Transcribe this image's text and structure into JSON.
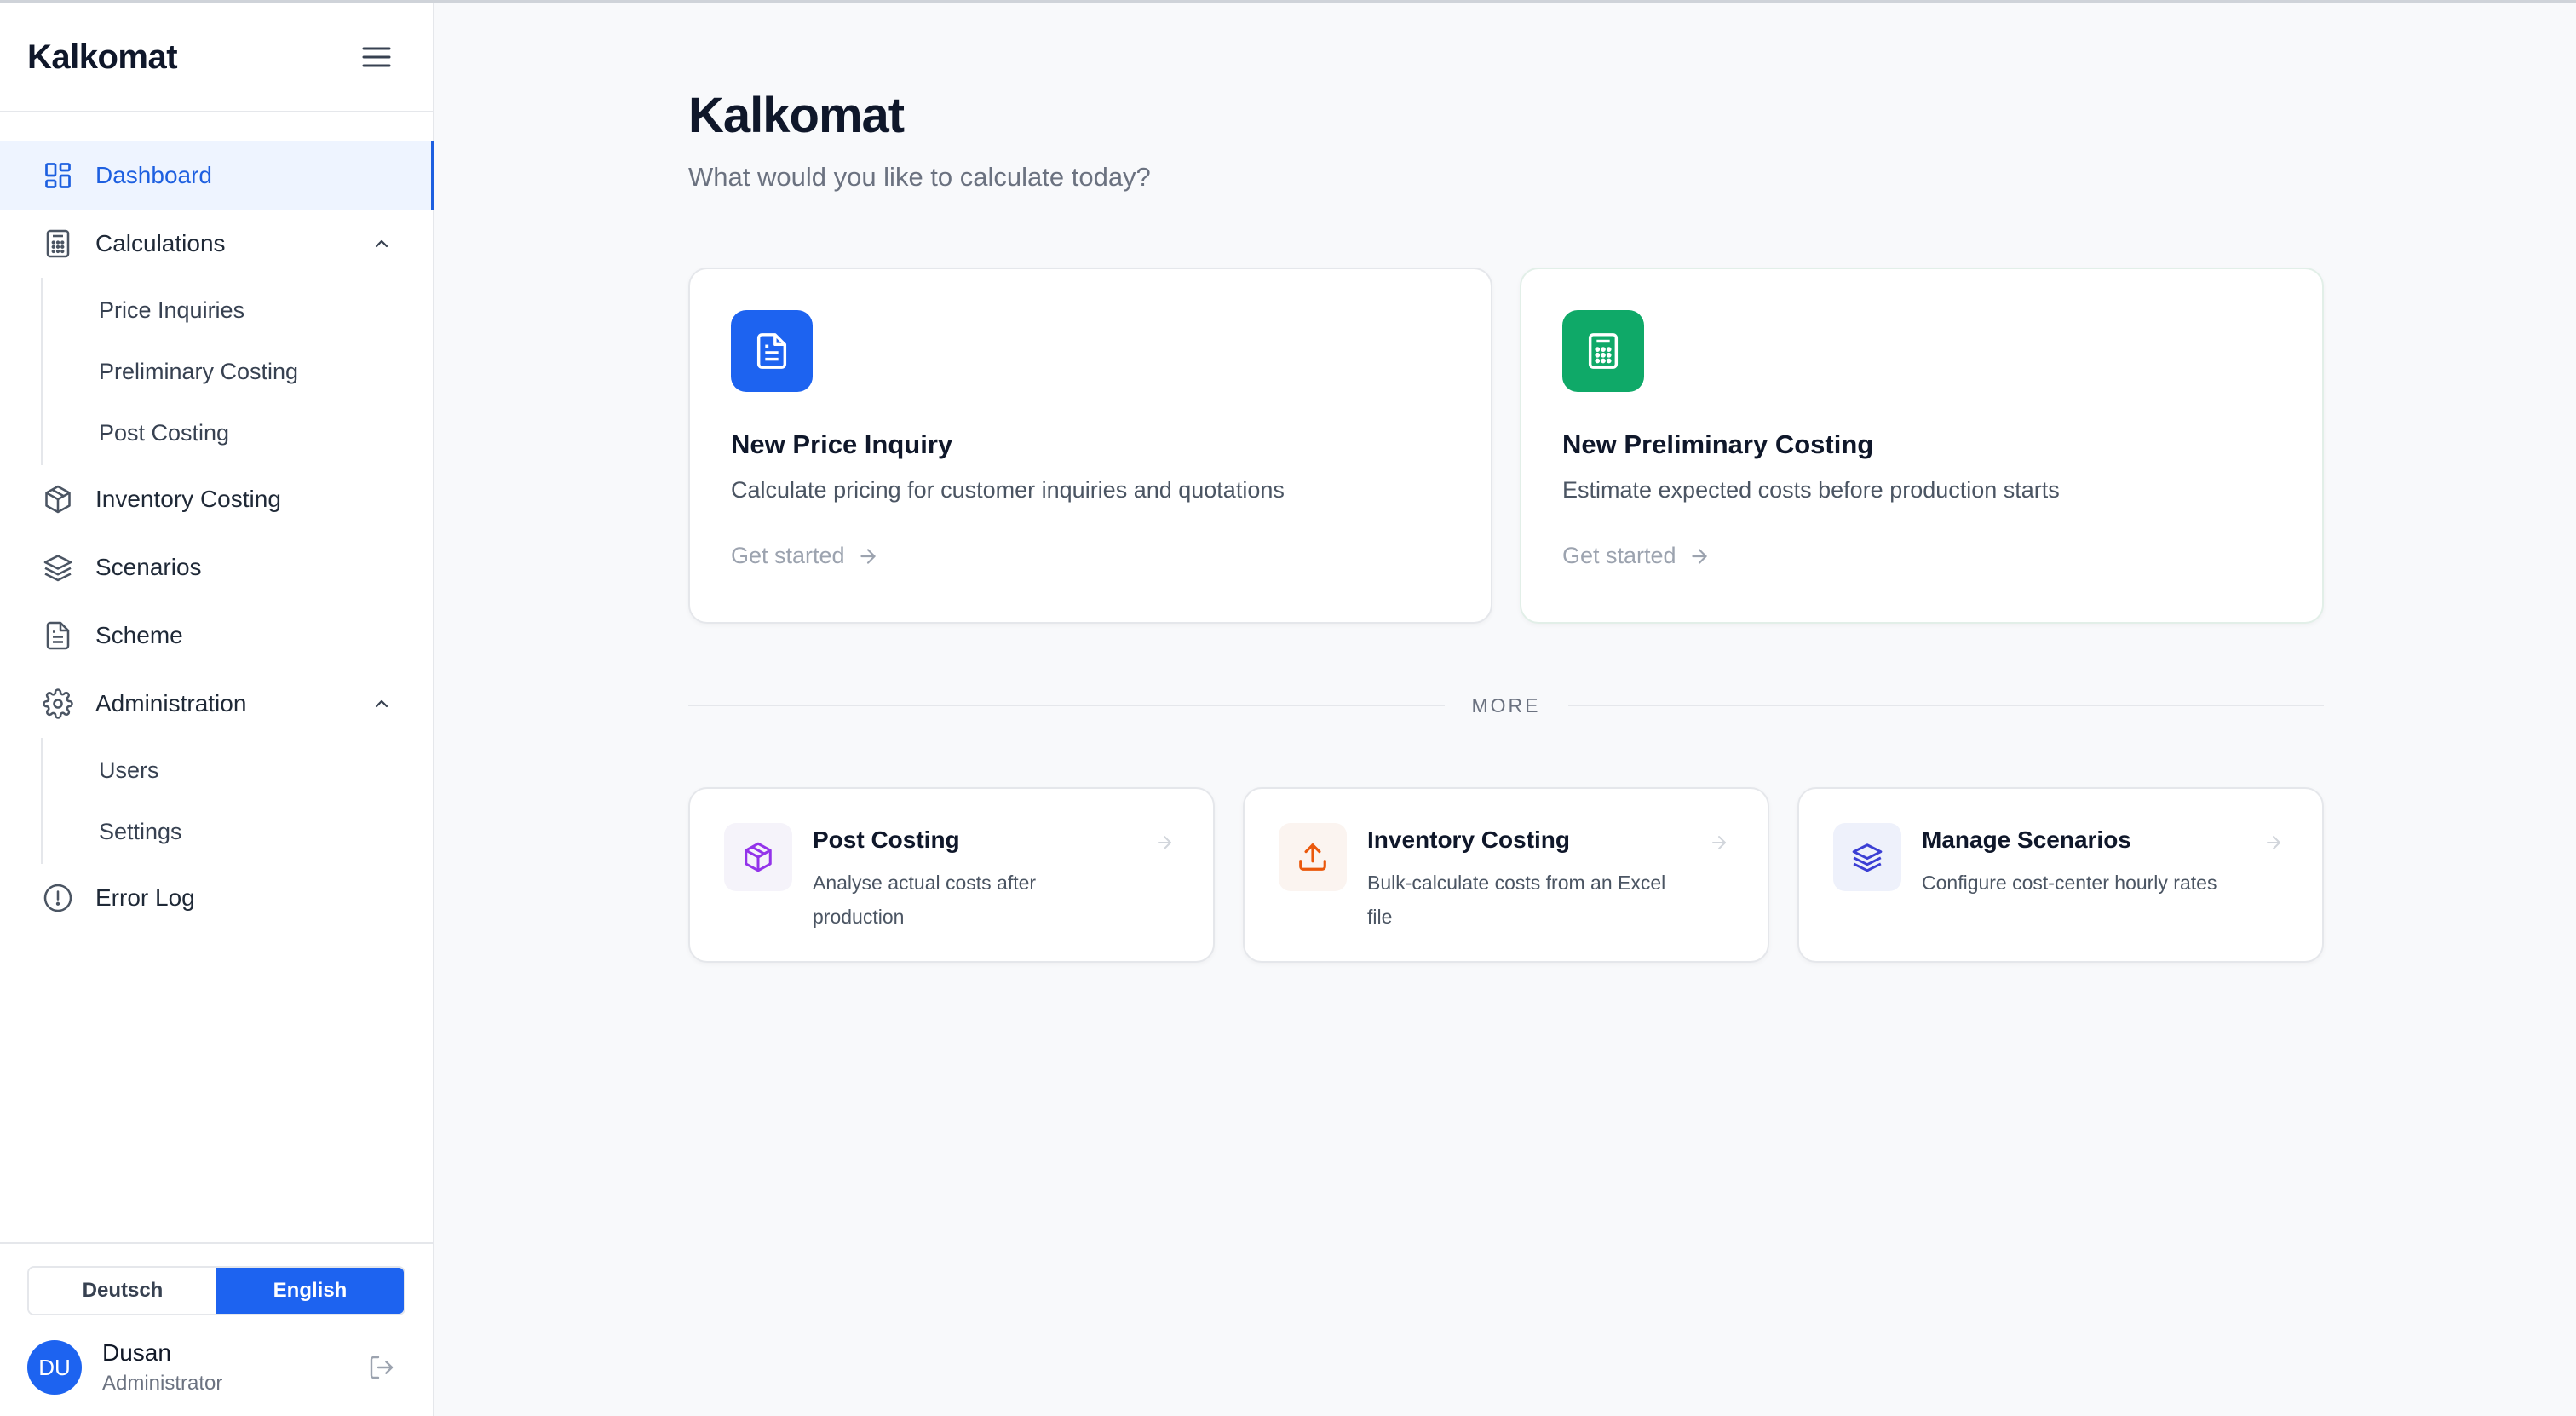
{
  "sidebar": {
    "brand": "Kalkomat",
    "nav": {
      "dashboard": "Dashboard",
      "calculations": "Calculations",
      "calculations_sub": [
        "Price Inquiries",
        "Preliminary Costing",
        "Post Costing"
      ],
      "inventory_costing": "Inventory Costing",
      "scenarios": "Scenarios",
      "scheme": "Scheme",
      "administration": "Administration",
      "administration_sub": [
        "Users",
        "Settings"
      ],
      "error_log": "Error Log"
    },
    "language": {
      "deutsch": "Deutsch",
      "english": "English",
      "selected": "English"
    },
    "user": {
      "initials": "DU",
      "name": "Dusan",
      "role": "Administrator"
    }
  },
  "main": {
    "title": "Kalkomat",
    "subtitle": "What would you like to calculate today?",
    "primary_cards": [
      {
        "title": "New Price Inquiry",
        "description": "Calculate pricing for customer inquiries and quotations",
        "link": "Get started",
        "icon": "document-icon",
        "color": "#1d63f0"
      },
      {
        "title": "New Preliminary Costing",
        "description": "Estimate expected costs before production starts",
        "link": "Get started",
        "icon": "calculator-icon",
        "color": "#0fa968"
      }
    ],
    "divider_label": "MORE",
    "secondary_cards": [
      {
        "title": "Post Costing",
        "description": "Analyse actual costs after production",
        "icon": "package-icon",
        "color": "#9333ea"
      },
      {
        "title": "Inventory Costing",
        "description": "Bulk-calculate costs from an Excel file",
        "icon": "upload-icon",
        "color": "#ea580c"
      },
      {
        "title": "Manage Scenarios",
        "description": "Configure cost-center hourly rates",
        "icon": "layers-icon",
        "color": "#3b3fd4"
      }
    ]
  }
}
